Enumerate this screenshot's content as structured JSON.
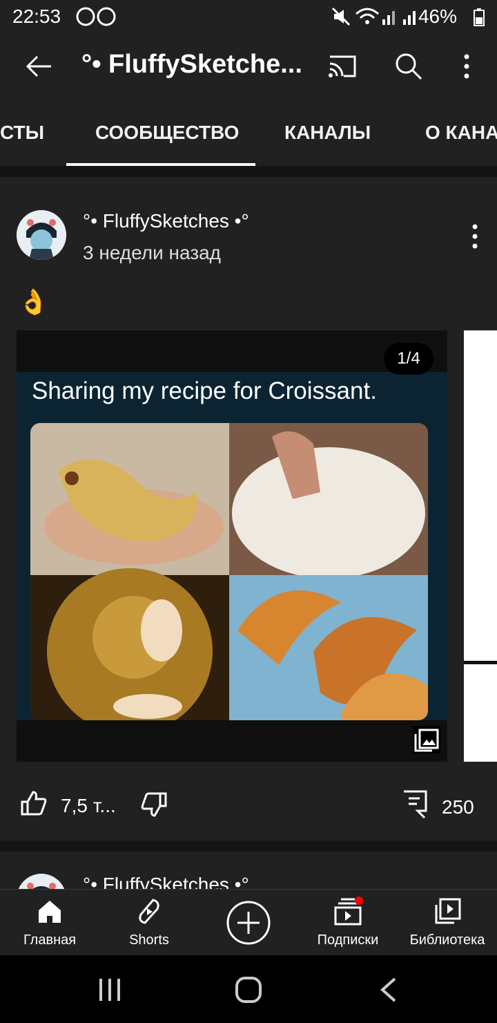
{
  "status_bar": {
    "time": "22:53",
    "battery": "46%"
  },
  "app_bar": {
    "title": "°• FluffySketche..."
  },
  "tabs": [
    {
      "label": "СТЫ"
    },
    {
      "label": "СООБЩЕСТВО"
    },
    {
      "label": "КАНАЛЫ"
    },
    {
      "label": "О КАНА"
    }
  ],
  "post": {
    "author": "°• FluffySketches •°",
    "time_ago": "3 недели назад",
    "emoji": "👌",
    "image_caption": "Sharing my recipe for Croissant.",
    "image_counter": "1/4",
    "likes": "7,5 т...",
    "comments": "250"
  },
  "next_post": {
    "author": "°• FluffySketches •°"
  },
  "bottom_nav": [
    {
      "label": "Главная"
    },
    {
      "label": "Shorts"
    },
    {
      "label": ""
    },
    {
      "label": "Подписки"
    },
    {
      "label": "Библиотека"
    }
  ]
}
